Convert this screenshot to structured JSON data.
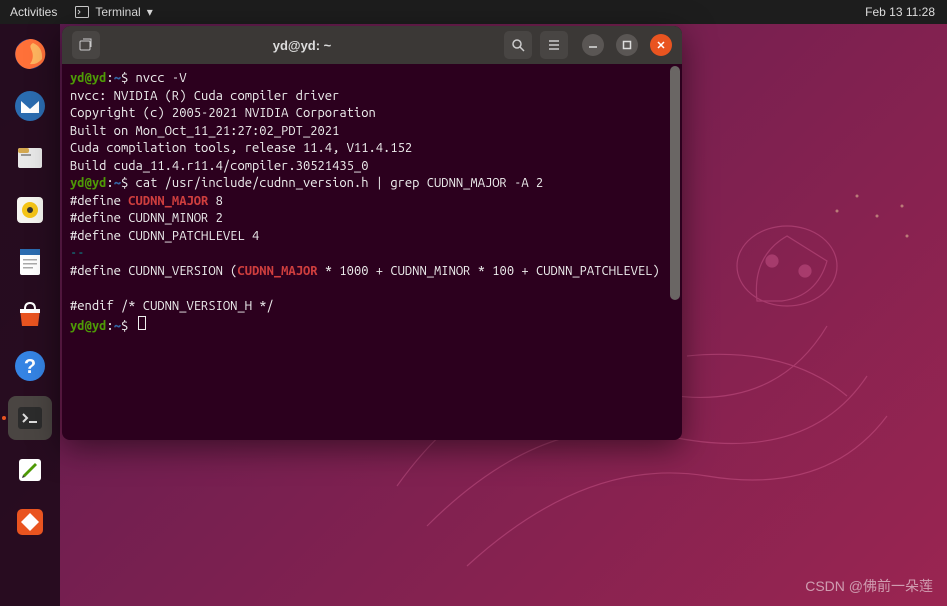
{
  "topbar": {
    "activities": "Activities",
    "app_name": "Terminal",
    "datetime": "Feb 13  11:28"
  },
  "window": {
    "title": "yd@yd: ~"
  },
  "prompt": {
    "user": "yd",
    "host": "yd",
    "path": "~",
    "sep1": "@",
    "sep2": ":",
    "dollar": "$ "
  },
  "terminal": {
    "cmd1": "nvcc -V",
    "out1_l1": "nvcc: NVIDIA (R) Cuda compiler driver",
    "out1_l2": "Copyright (c) 2005-2021 NVIDIA Corporation",
    "out1_l3": "Built on Mon_Oct_11_21:27:02_PDT_2021",
    "out1_l4": "Cuda compilation tools, release 11.4, V11.4.152",
    "out1_l5": "Build cuda_11.4.r11.4/compiler.30521435_0",
    "cmd2": "cat /usr/include/cudnn_version.h | grep CUDNN_MAJOR -A 2",
    "def_pre": "#define ",
    "major_key": "CUDNN_MAJOR",
    "major_val": " 8",
    "minor": "#define CUDNN_MINOR 2",
    "patch": "#define CUDNN_PATCHLEVEL 4",
    "sep": "--",
    "ver_a": "#define CUDNN_VERSION (",
    "ver_b": " * 1000 + CUDNN_MINOR * 100 + CUDNN_PATCHLEVEL)",
    "blank": "",
    "endif": "#endif /* CUDNN_VERSION_H */"
  },
  "watermark": "CSDN @佛前一朵莲"
}
